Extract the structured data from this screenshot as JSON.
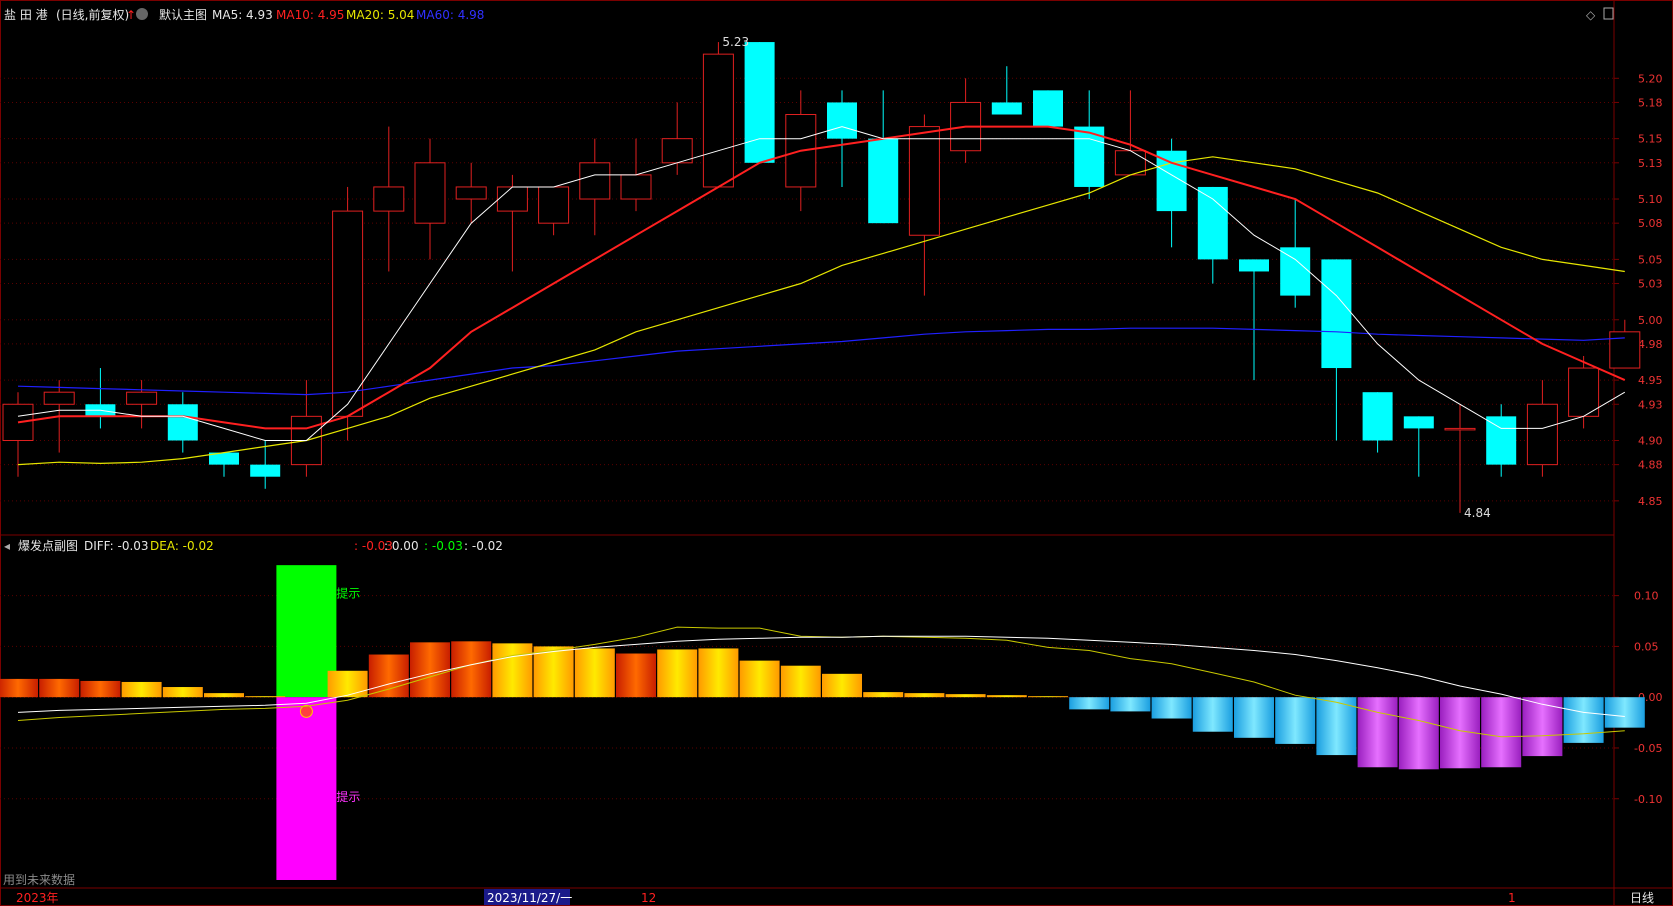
{
  "header": {
    "stock_name": "盐 田 港",
    "period_note": "(日线,前复权)",
    "main_chart_label": "默认主图",
    "ma5": "MA5: 4.93",
    "ma10": "MA10: 4.95",
    "ma20": "MA20: 5.04",
    "ma60": "MA60: 4.98"
  },
  "sub_header": {
    "title": "爆发点副图",
    "diff": "DIFF: -0.03",
    "dea": "DEA: -0.02",
    "extra_red": ": -0.03",
    "extra_white": ": 0.00",
    "extra_green": ": -0.03",
    "extra_last": ": -0.02",
    "signal_up_text": "提示",
    "signal_down_text": "提示"
  },
  "footer": {
    "left_note": "用到未来数据",
    "year_label": "2023年",
    "cursor_date": "2023/11/27/一",
    "month_12": "12",
    "month_1": "1",
    "period_button": "日线"
  },
  "colors": {
    "up": "#e02020",
    "down": "#00ffff",
    "ma5": "#ffffff",
    "ma10": "#ff2020",
    "ma20": "#e6e600",
    "ma60": "#2020ff",
    "grid": "#5a0000",
    "axis_text": "#e03030"
  },
  "chart_data": [
    {
      "type": "candlestick",
      "title": "盐 田 港 (日线,前复权)",
      "ylim": [
        4.83,
        5.24
      ],
      "yticks": [
        4.85,
        4.88,
        4.9,
        4.93,
        4.95,
        4.98,
        5.0,
        5.03,
        5.05,
        5.08,
        5.1,
        5.13,
        5.15,
        5.18,
        5.2
      ],
      "annotations": {
        "high_label": "5.23",
        "low_label": "4.84"
      },
      "candles": [
        {
          "o": 4.9,
          "h": 4.94,
          "l": 4.87,
          "c": 4.93
        },
        {
          "o": 4.93,
          "h": 4.95,
          "l": 4.89,
          "c": 4.94
        },
        {
          "o": 4.93,
          "h": 4.96,
          "l": 4.91,
          "c": 4.92
        },
        {
          "o": 4.93,
          "h": 4.95,
          "l": 4.91,
          "c": 4.94
        },
        {
          "o": 4.93,
          "h": 4.94,
          "l": 4.89,
          "c": 4.9
        },
        {
          "o": 4.89,
          "h": 4.89,
          "l": 4.87,
          "c": 4.88
        },
        {
          "o": 4.88,
          "h": 4.9,
          "l": 4.86,
          "c": 4.87
        },
        {
          "o": 4.88,
          "h": 4.95,
          "l": 4.87,
          "c": 4.92
        },
        {
          "o": 4.92,
          "h": 5.11,
          "l": 4.9,
          "c": 5.09
        },
        {
          "o": 5.09,
          "h": 5.16,
          "l": 5.04,
          "c": 5.11
        },
        {
          "o": 5.08,
          "h": 5.15,
          "l": 5.05,
          "c": 5.13
        },
        {
          "o": 5.1,
          "h": 5.13,
          "l": 5.08,
          "c": 5.11
        },
        {
          "o": 5.09,
          "h": 5.12,
          "l": 5.04,
          "c": 5.11
        },
        {
          "o": 5.08,
          "h": 5.11,
          "l": 5.07,
          "c": 5.11
        },
        {
          "o": 5.1,
          "h": 5.15,
          "l": 5.07,
          "c": 5.13
        },
        {
          "o": 5.1,
          "h": 5.15,
          "l": 5.09,
          "c": 5.12
        },
        {
          "o": 5.13,
          "h": 5.18,
          "l": 5.12,
          "c": 5.15
        },
        {
          "o": 5.11,
          "h": 5.23,
          "l": 5.11,
          "c": 5.22
        },
        {
          "o": 5.23,
          "h": 5.23,
          "l": 5.13,
          "c": 5.13
        },
        {
          "o": 5.11,
          "h": 5.19,
          "l": 5.09,
          "c": 5.17
        },
        {
          "o": 5.18,
          "h": 5.19,
          "l": 5.11,
          "c": 5.15
        },
        {
          "o": 5.15,
          "h": 5.19,
          "l": 5.08,
          "c": 5.08
        },
        {
          "o": 5.07,
          "h": 5.17,
          "l": 5.02,
          "c": 5.16
        },
        {
          "o": 5.14,
          "h": 5.2,
          "l": 5.13,
          "c": 5.18
        },
        {
          "o": 5.18,
          "h": 5.21,
          "l": 5.17,
          "c": 5.17
        },
        {
          "o": 5.19,
          "h": 5.19,
          "l": 5.16,
          "c": 5.16
        },
        {
          "o": 5.16,
          "h": 5.19,
          "l": 5.1,
          "c": 5.11
        },
        {
          "o": 5.12,
          "h": 5.19,
          "l": 5.12,
          "c": 5.14
        },
        {
          "o": 5.14,
          "h": 5.15,
          "l": 5.06,
          "c": 5.09
        },
        {
          "o": 5.11,
          "h": 5.11,
          "l": 5.03,
          "c": 5.05
        },
        {
          "o": 5.05,
          "h": 5.05,
          "l": 4.95,
          "c": 5.04
        },
        {
          "o": 5.06,
          "h": 5.1,
          "l": 5.01,
          "c": 5.02
        },
        {
          "o": 5.05,
          "h": 5.05,
          "l": 4.9,
          "c": 4.96
        },
        {
          "o": 4.94,
          "h": 4.94,
          "l": 4.89,
          "c": 4.9
        },
        {
          "o": 4.92,
          "h": 4.92,
          "l": 4.87,
          "c": 4.91
        },
        {
          "o": 4.91,
          "h": 4.93,
          "l": 4.84,
          "c": 4.91
        },
        {
          "o": 4.92,
          "h": 4.93,
          "l": 4.87,
          "c": 4.88
        },
        {
          "o": 4.88,
          "h": 4.95,
          "l": 4.87,
          "c": 4.93
        },
        {
          "o": 4.92,
          "h": 4.97,
          "l": 4.91,
          "c": 4.96
        },
        {
          "o": 4.96,
          "h": 5.0,
          "l": 4.96,
          "c": 4.99
        }
      ],
      "ma5": [
        4.92,
        4.925,
        4.925,
        4.92,
        4.92,
        4.91,
        4.9,
        4.9,
        4.93,
        4.98,
        5.03,
        5.08,
        5.11,
        5.11,
        5.12,
        5.12,
        5.13,
        5.14,
        5.15,
        5.15,
        5.16,
        5.15,
        5.15,
        5.15,
        5.15,
        5.15,
        5.15,
        5.14,
        5.12,
        5.1,
        5.07,
        5.05,
        5.02,
        4.98,
        4.95,
        4.93,
        4.91,
        4.91,
        4.92,
        4.94
      ],
      "ma10": [
        4.915,
        4.92,
        4.92,
        4.92,
        4.92,
        4.915,
        4.91,
        4.91,
        4.92,
        4.94,
        4.96,
        4.99,
        5.01,
        5.03,
        5.05,
        5.07,
        5.09,
        5.11,
        5.13,
        5.14,
        5.145,
        5.15,
        5.155,
        5.16,
        5.16,
        5.16,
        5.155,
        5.145,
        5.13,
        5.12,
        5.11,
        5.1,
        5.08,
        5.06,
        5.04,
        5.02,
        5.0,
        4.98,
        4.965,
        4.95
      ],
      "ma20": [
        4.88,
        4.882,
        4.881,
        4.882,
        4.885,
        4.89,
        4.895,
        4.9,
        4.91,
        4.92,
        4.935,
        4.945,
        4.955,
        4.965,
        4.975,
        4.99,
        5.0,
        5.01,
        5.02,
        5.03,
        5.045,
        5.055,
        5.065,
        5.075,
        5.085,
        5.095,
        5.105,
        5.12,
        5.13,
        5.135,
        5.13,
        5.125,
        5.115,
        5.105,
        5.09,
        5.075,
        5.06,
        5.05,
        5.045,
        5.04
      ],
      "ma60": [
        4.945,
        4.944,
        4.943,
        4.942,
        4.941,
        4.94,
        4.939,
        4.938,
        4.94,
        4.945,
        4.95,
        4.955,
        4.96,
        4.962,
        4.966,
        4.97,
        4.974,
        4.976,
        4.978,
        4.98,
        4.982,
        4.985,
        4.988,
        4.99,
        4.991,
        4.992,
        4.992,
        4.993,
        4.993,
        4.993,
        4.992,
        4.991,
        4.99,
        4.988,
        4.987,
        4.986,
        4.985,
        4.984,
        4.983,
        4.985
      ]
    },
    {
      "type": "bar",
      "title": "爆发点副图",
      "ylim": [
        -0.18,
        0.14
      ],
      "yticks": [
        -0.1,
        -0.05,
        0.0,
        0.05,
        0.1
      ],
      "ytick_labels": [
        "-0.10",
        "-0.05",
        "-0.00",
        "0.05",
        "0.10"
      ],
      "values": [
        0.018,
        0.018,
        0.016,
        0.015,
        0.01,
        0.004,
        0.001,
        0.002,
        0.026,
        0.042,
        0.054,
        0.055,
        0.053,
        0.05,
        0.048,
        0.043,
        0.047,
        0.048,
        0.036,
        0.031,
        0.023,
        0.005,
        0.004,
        0.003,
        0.002,
        0.001,
        -0.012,
        -0.014,
        -0.021,
        -0.034,
        -0.04,
        -0.046,
        -0.057,
        -0.069,
        -0.071,
        -0.07,
        -0.069,
        -0.058,
        -0.045,
        -0.03
      ],
      "diff": [
        -0.015,
        -0.013,
        -0.012,
        -0.011,
        -0.01,
        -0.009,
        -0.008,
        -0.006,
        0.002,
        0.013,
        0.023,
        0.032,
        0.04,
        0.045,
        0.049,
        0.052,
        0.055,
        0.057,
        0.058,
        0.059,
        0.059,
        0.06,
        0.06,
        0.06,
        0.059,
        0.058,
        0.056,
        0.054,
        0.052,
        0.049,
        0.046,
        0.042,
        0.036,
        0.029,
        0.021,
        0.011,
        0.003,
        -0.007,
        -0.015,
        -0.019
      ],
      "dea": [
        -0.023,
        -0.02,
        -0.018,
        -0.016,
        -0.014,
        -0.012,
        -0.011,
        -0.009,
        -0.003,
        0.008,
        0.02,
        0.032,
        0.041,
        0.046,
        0.052,
        0.059,
        0.069,
        0.068,
        0.068,
        0.06,
        0.059,
        0.06,
        0.059,
        0.058,
        0.056,
        0.049,
        0.046,
        0.038,
        0.033,
        0.024,
        0.015,
        0.002,
        -0.005,
        -0.015,
        -0.023,
        -0.033,
        -0.039,
        -0.038,
        -0.036,
        -0.033
      ],
      "signal_index": 7,
      "signal_top": 0.13,
      "signal_bottom": -0.18
    }
  ]
}
